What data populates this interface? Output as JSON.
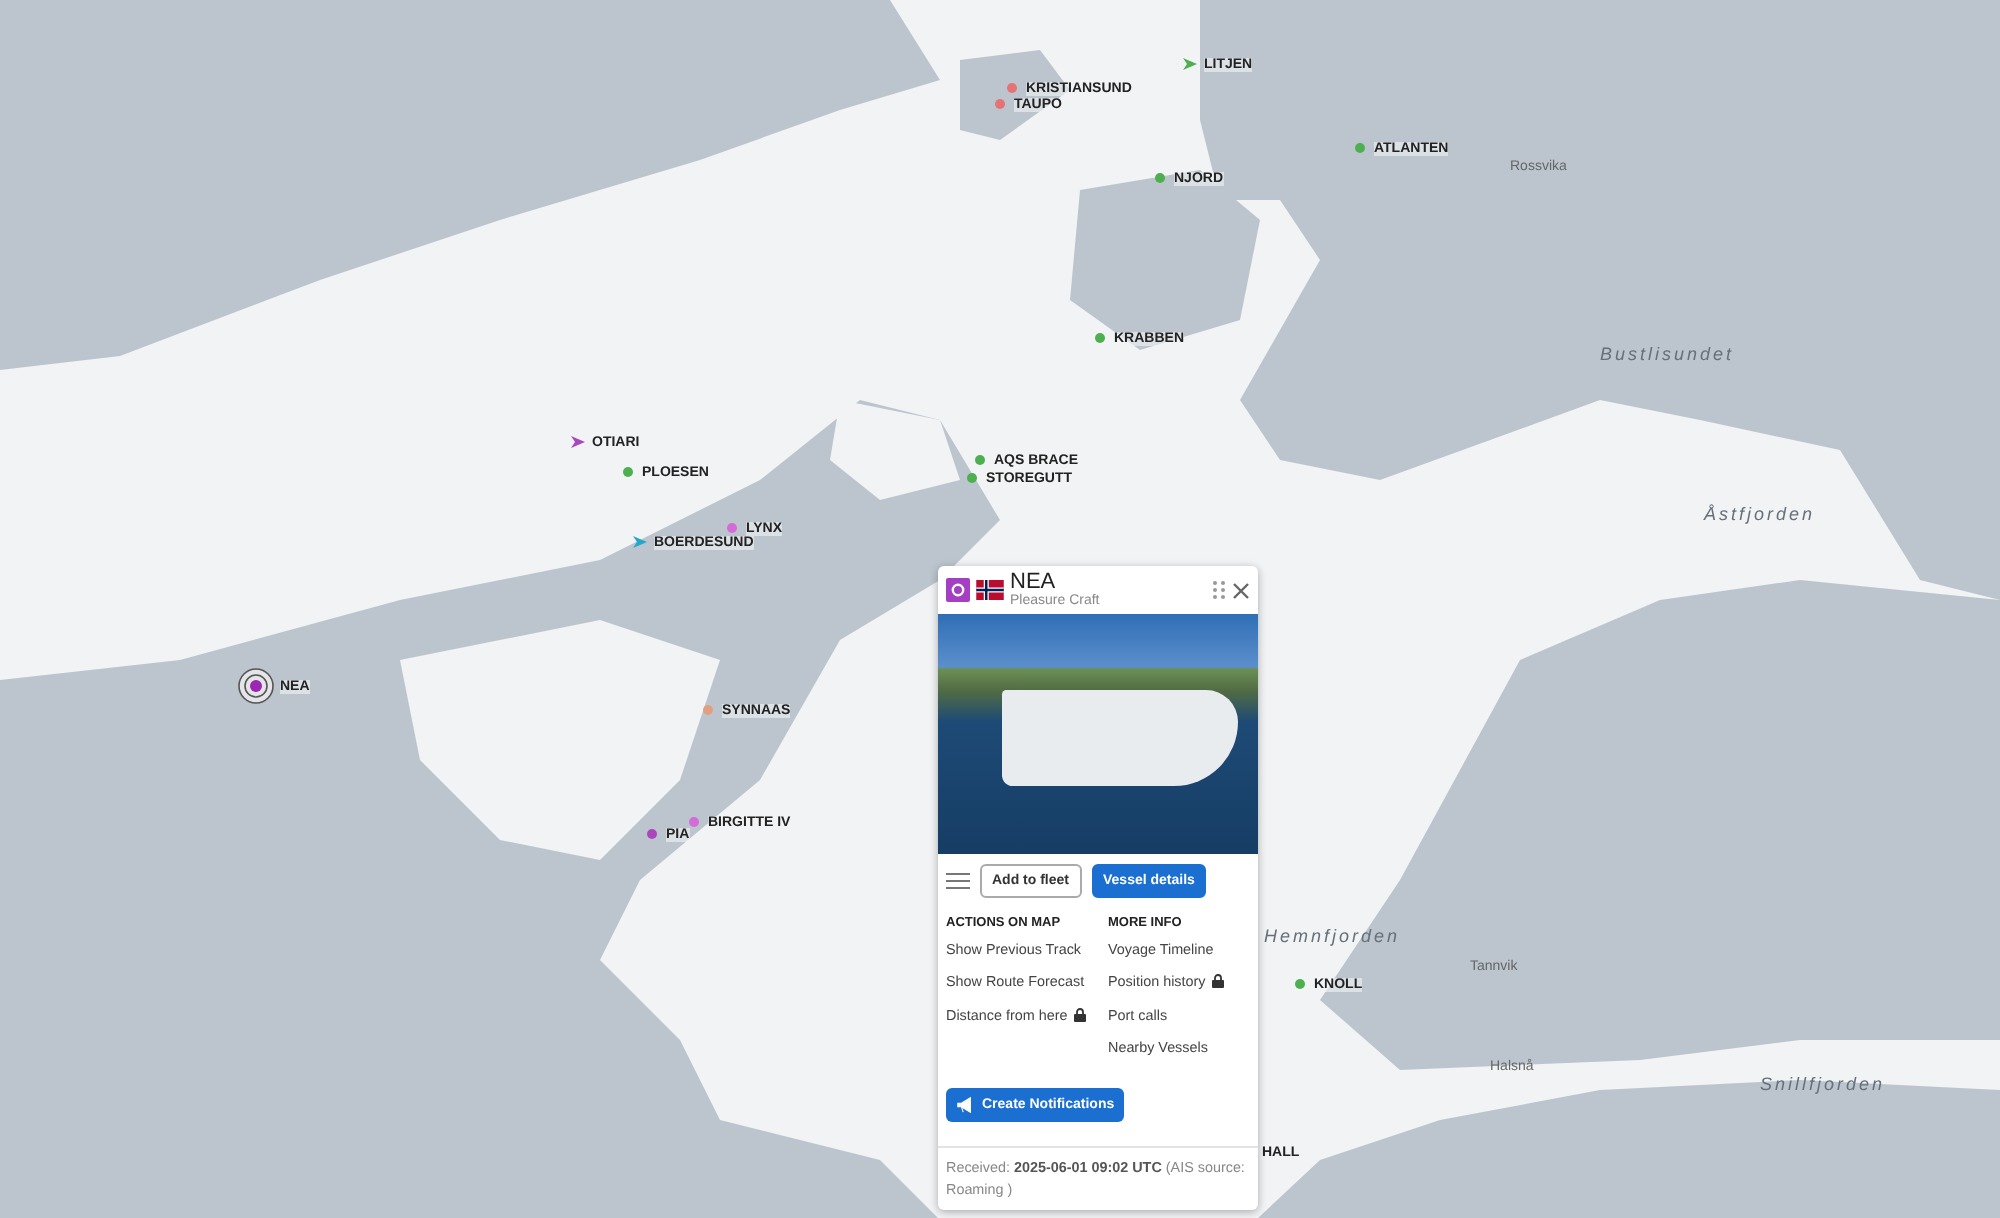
{
  "vessels": [
    {
      "name": "LITJEN",
      "kind": "arrow",
      "color": "#4caf50",
      "selected": false
    },
    {
      "name": "KRISTIANSUND",
      "kind": "dot",
      "color": "#e57373",
      "selected": false
    },
    {
      "name": "TAUPO",
      "kind": "dot",
      "color": "#e57373",
      "selected": false
    },
    {
      "name": "NJORD",
      "kind": "dot",
      "color": "#4caf50",
      "selected": false
    },
    {
      "name": "ATLANTEN",
      "kind": "dot",
      "color": "#4caf50",
      "selected": false
    },
    {
      "name": "KRABBEN",
      "kind": "dot",
      "color": "#4caf50",
      "selected": false
    },
    {
      "name": "OTIARI",
      "kind": "arrow",
      "color": "#ab47bc",
      "selected": false
    },
    {
      "name": "PLOESEN",
      "kind": "dot",
      "color": "#4caf50",
      "selected": false
    },
    {
      "name": "LYNX",
      "kind": "dot",
      "color": "#d36bd8",
      "selected": false
    },
    {
      "name": "BOERDESUND",
      "kind": "arrow",
      "color": "#26a6c9",
      "selected": false
    },
    {
      "name": "AQS BRACE",
      "kind": "dot",
      "color": "#4caf50",
      "selected": false
    },
    {
      "name": "STOREGUTT",
      "kind": "dot",
      "color": "#4caf50",
      "selected": false
    },
    {
      "name": "NEA",
      "kind": "dot",
      "color": "#9c27b0",
      "selected": true
    },
    {
      "name": "SYNNAAS",
      "kind": "dot",
      "color": "#e0a080",
      "selected": false
    },
    {
      "name": "PIA",
      "kind": "dot",
      "color": "#ab47bc",
      "selected": false
    },
    {
      "name": "BIRGITTE IV",
      "kind": "dot",
      "color": "#d36bd8",
      "selected": false
    },
    {
      "name": "KNOLL",
      "kind": "dot",
      "color": "#4caf50",
      "selected": false
    },
    {
      "name": "HALL",
      "selected": false
    }
  ],
  "places": [
    {
      "name": "Bustlisundet",
      "kind": "water"
    },
    {
      "name": "Åstfjorden",
      "kind": "water"
    },
    {
      "name": "Hemnfjorden",
      "kind": "water"
    },
    {
      "name": "Snillfjorden",
      "kind": "water"
    },
    {
      "name": "Rossvika",
      "kind": "land"
    },
    {
      "name": "Tannvik",
      "kind": "land"
    },
    {
      "name": "Halsnå",
      "kind": "land"
    }
  ],
  "popup": {
    "name": "NEA",
    "type": "Pleasure Craft",
    "buttons": [
      "Add to fleet",
      "Vessel details"
    ],
    "actions": {
      "title": "ACTIONS ON MAP",
      "items": [
        {
          "label": "Show Previous Track",
          "locked": false
        },
        {
          "label": "Show Route Forecast",
          "locked": false
        },
        {
          "label": "Distance from here",
          "locked": true
        }
      ]
    },
    "more_info": {
      "title": "MORE INFO",
      "items": [
        {
          "label": "Voyage Timeline",
          "locked": false
        },
        {
          "label": "Position history",
          "locked": true
        },
        {
          "label": "Port calls",
          "locked": false
        },
        {
          "label": "Nearby Vessels",
          "locked": false
        }
      ]
    },
    "notify_button": "Create Notifications",
    "received": "Received: **2025-06-01 09:02 UTC** (AIS source: Roaming )"
  }
}
